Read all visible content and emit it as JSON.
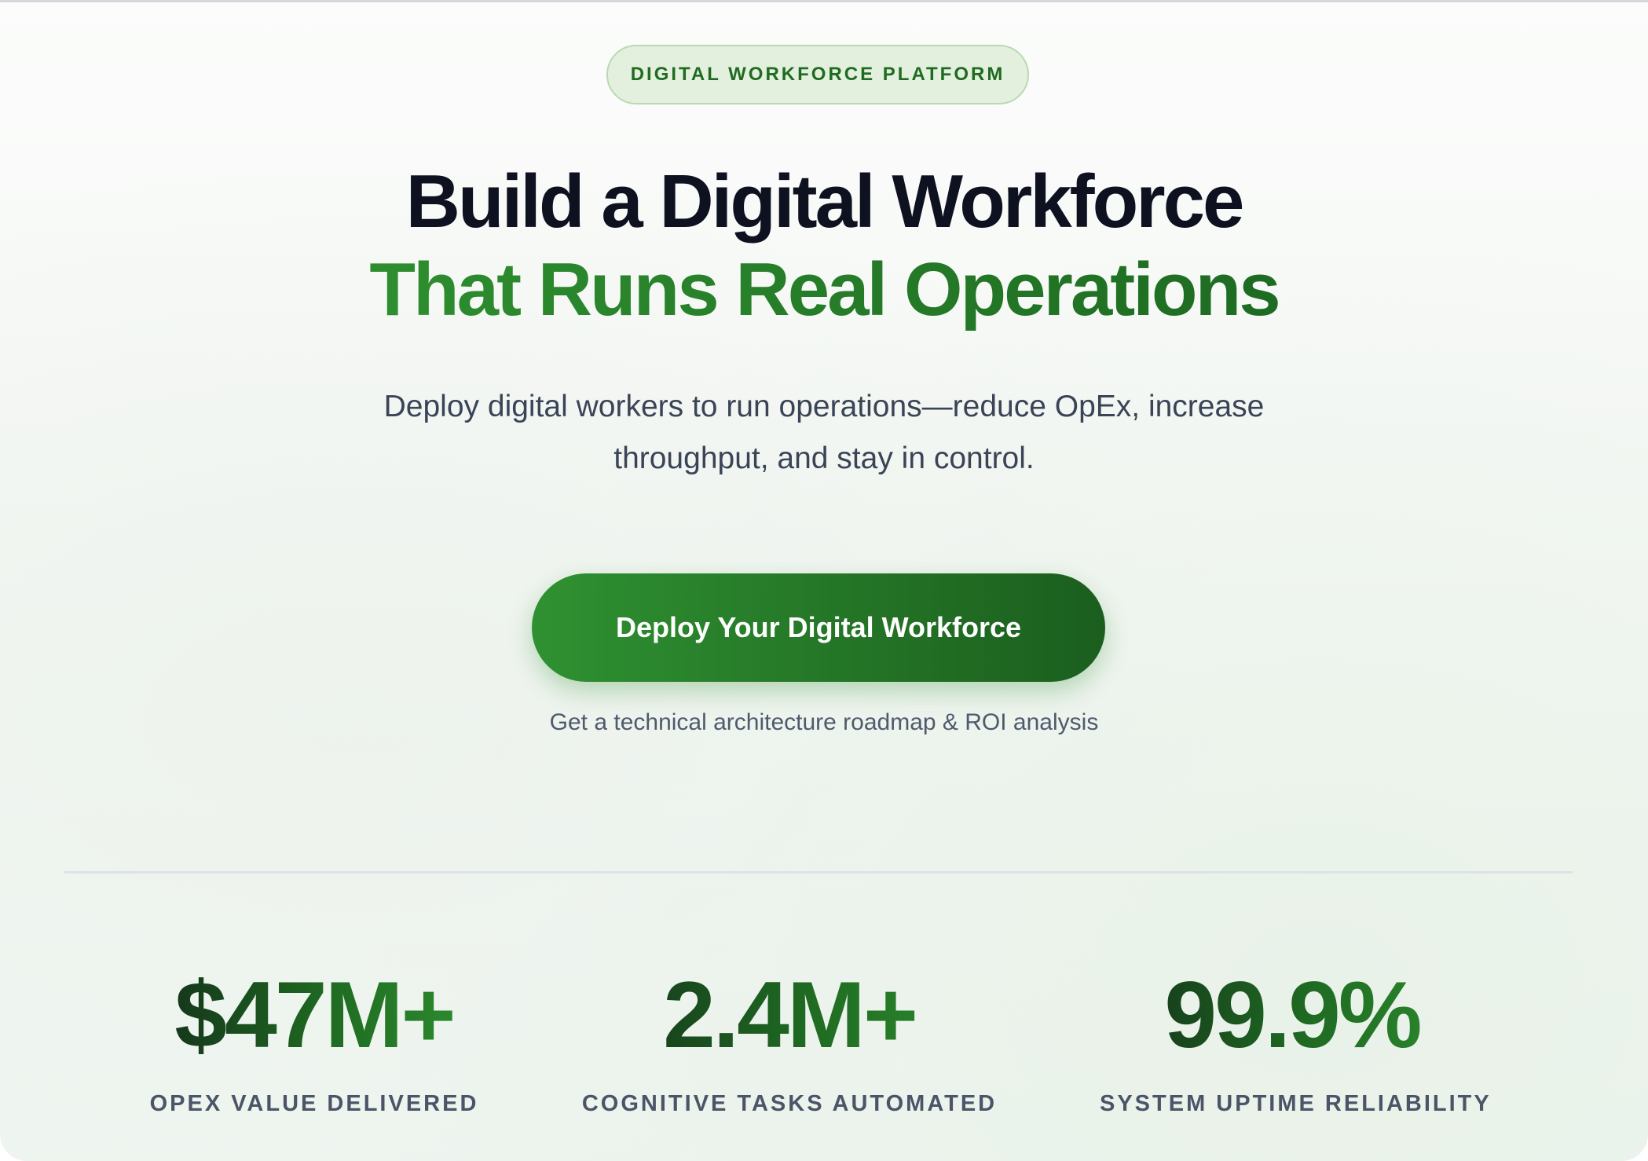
{
  "hero": {
    "badge": "DIGITAL WORKFORCE PLATFORM",
    "headline_line1": "Build a Digital Workforce",
    "headline_line2": "That Runs Real Operations",
    "subtitle_line1": "Deploy digital workers to run operations—reduce OpEx, increase",
    "subtitle_line2": "throughput, and stay in control.",
    "cta_label": "Deploy Your Digital Workforce",
    "cta_note": "Get a technical architecture roadmap & ROI analysis"
  },
  "stats": [
    {
      "value": "$47M+",
      "label": "OPEX VALUE DELIVERED"
    },
    {
      "value": "2.4M+",
      "label": "COGNITIVE TASKS AUTOMATED"
    },
    {
      "value": "99.9%",
      "label": "SYSTEM UPTIME RELIABILITY"
    }
  ],
  "colors": {
    "accent_green": "#2e8e2f",
    "accent_green_dark": "#1b5e1e",
    "heading_dark": "#0d1120",
    "badge_bg": "#e3f0dd"
  }
}
